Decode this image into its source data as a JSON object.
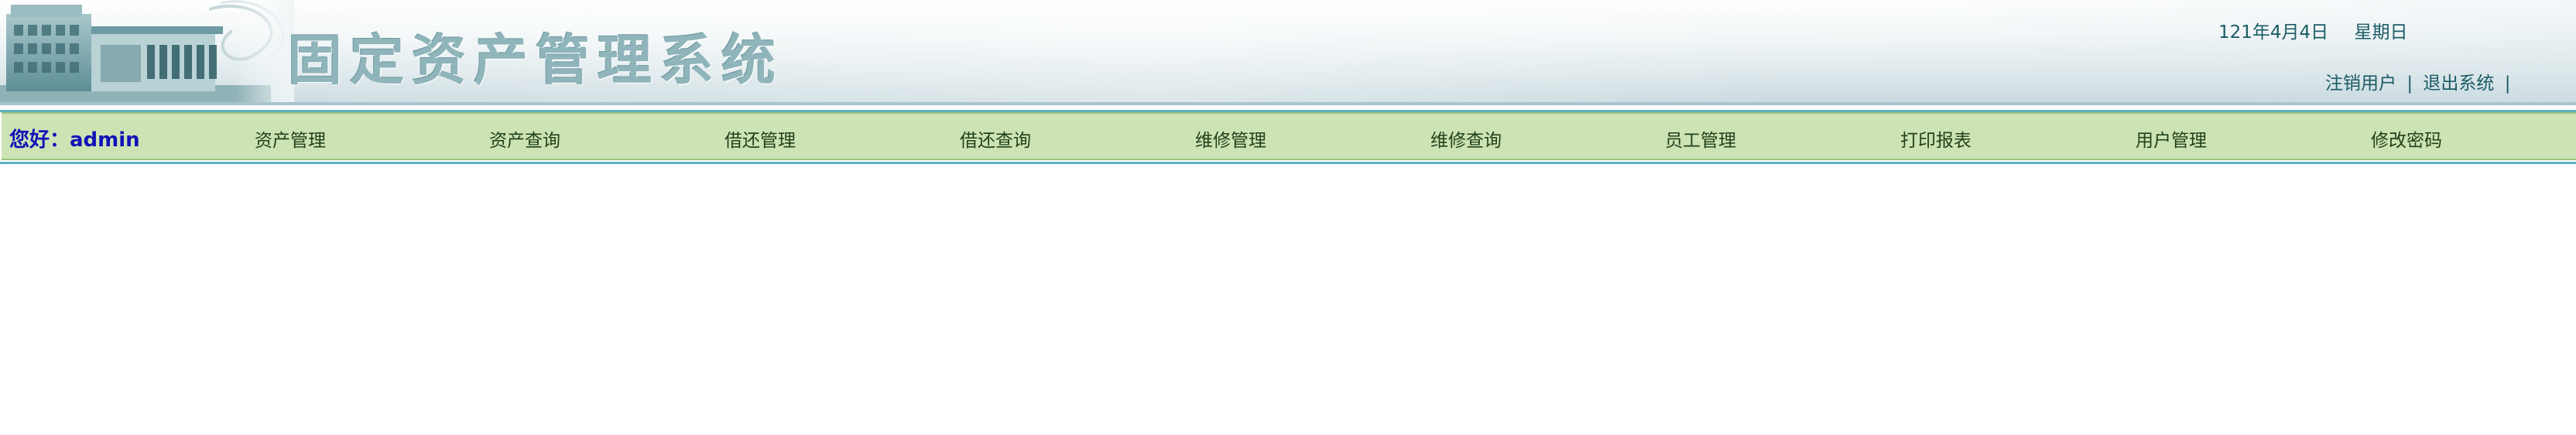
{
  "header": {
    "system_title": "固定资产管理系统",
    "date": "121年4月4日",
    "weekday": "星期日",
    "links": {
      "logout_user": "注销用户",
      "exit_system": "退出系统",
      "separator": "|"
    }
  },
  "nav": {
    "greeting_prefix": "您好：",
    "username": "admin",
    "items": [
      {
        "label": "资产管理"
      },
      {
        "label": "资产查询"
      },
      {
        "label": "借还管理"
      },
      {
        "label": "借还查询"
      },
      {
        "label": "维修管理"
      },
      {
        "label": "维修查询"
      },
      {
        "label": "员工管理"
      },
      {
        "label": "打印报表"
      },
      {
        "label": "用户管理"
      },
      {
        "label": "修改密码"
      }
    ]
  },
  "colors": {
    "nav_background": "#cde3b4",
    "nav_border": "#5fb2c2",
    "greeting_text": "#1212b8",
    "title_text": "#8fb5bb",
    "header_link_text": "#1b5b66"
  }
}
